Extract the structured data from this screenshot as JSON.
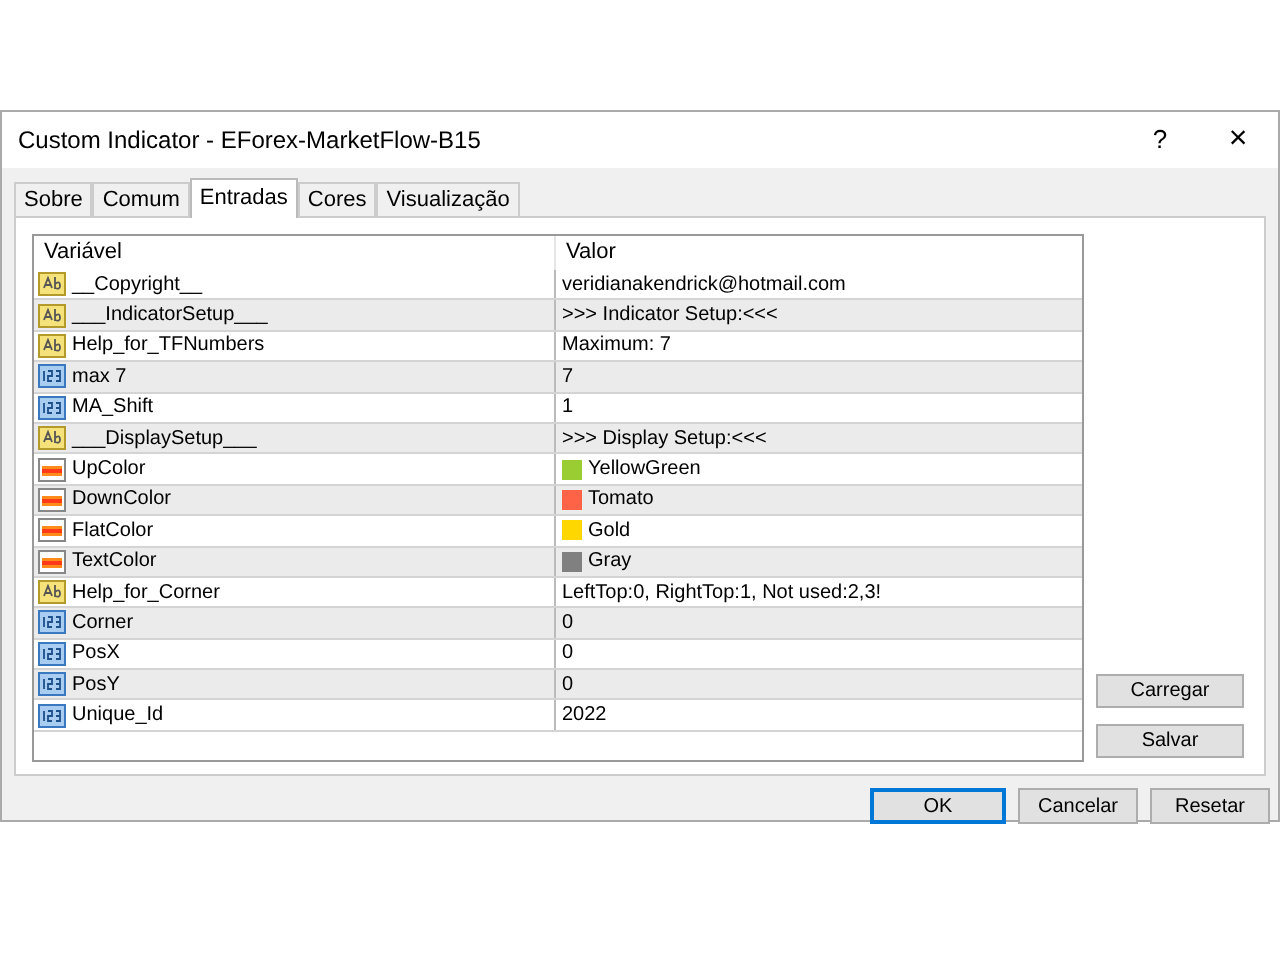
{
  "window": {
    "title": "Custom Indicator - EForex-MarketFlow-B15",
    "help": "?",
    "close": "×"
  },
  "tabs": [
    {
      "label": "Sobre",
      "selected": false
    },
    {
      "label": "Comum",
      "selected": false
    },
    {
      "label": "Entradas",
      "selected": true
    },
    {
      "label": "Cores",
      "selected": false
    },
    {
      "label": "Visualização",
      "selected": false
    }
  ],
  "table": {
    "columns": [
      "Variável",
      "Valor"
    ],
    "rows": [
      {
        "kind": "text",
        "name": "__Copyright__",
        "value": "veridianakendrick@hotmail.com"
      },
      {
        "kind": "text",
        "name": "___IndicatorSetup___",
        "value": ">>> Indicator Setup:<<<"
      },
      {
        "kind": "text",
        "name": "Help_for_TFNumbers",
        "value": "Maximum: 7"
      },
      {
        "kind": "int",
        "name": "max 7",
        "value": "7"
      },
      {
        "kind": "int",
        "name": "MA_Shift",
        "value": "1"
      },
      {
        "kind": "text",
        "name": "___DisplaySetup___",
        "value": ">>> Display Setup:<<<"
      },
      {
        "kind": "color",
        "name": "UpColor",
        "value": "YellowGreen",
        "color": "#9acd32"
      },
      {
        "kind": "color",
        "name": "DownColor",
        "value": "Tomato",
        "color": "#ff6347"
      },
      {
        "kind": "color",
        "name": "FlatColor",
        "value": "Gold",
        "color": "#ffd700"
      },
      {
        "kind": "color",
        "name": "TextColor",
        "value": "Gray",
        "color": "#808080"
      },
      {
        "kind": "text",
        "name": "Help_for_Corner",
        "value": "LeftTop:0, RightTop:1, Not used:2,3!"
      },
      {
        "kind": "int",
        "name": "Corner",
        "value": "0"
      },
      {
        "kind": "int",
        "name": "PosX",
        "value": "0"
      },
      {
        "kind": "int",
        "name": "PosY",
        "value": "0"
      },
      {
        "kind": "int",
        "name": "Unique_Id",
        "value": "2022"
      }
    ]
  },
  "side_buttons": [
    "Carregar",
    "Salvar"
  ],
  "buttons": [
    {
      "label": "OK",
      "default": true
    },
    {
      "label": "Cancelar",
      "default": false
    },
    {
      "label": "Resetar",
      "default": false
    }
  ]
}
